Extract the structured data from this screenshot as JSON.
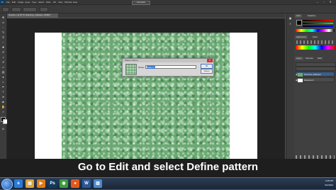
{
  "app": {
    "logo": "Ps",
    "menu": [
      "File",
      "Edit",
      "Image",
      "Layer",
      "Type",
      "Select",
      "Filter",
      "3D",
      "View",
      "Window",
      "Help"
    ],
    "workspace": "Essentials"
  },
  "document": {
    "tab_title": "Snowline 1 @ 66.7% (Raindrops_Wallpaper, RGB/8) *",
    "zoom_status": "66.67%"
  },
  "dialog": {
    "title": "Pattern Name",
    "name_label": "Name:",
    "name_value": "Pattern 1",
    "ok_label": "OK",
    "cancel_label": "Cancel",
    "close_glyph": "✕"
  },
  "panels": {
    "tabs_top": [
      "Color",
      "Swatches"
    ],
    "tabs_mid": [
      "Adjustments",
      "Styles"
    ],
    "tabs_layers": [
      "Layers",
      "Channels",
      "Paths"
    ],
    "layers": [
      {
        "name": "Raindrops_Wallpaper",
        "selected": true
      },
      {
        "name": "Background",
        "selected": false
      }
    ]
  },
  "caption": "Go to Edit and select Define pattern",
  "taskbar": {
    "icons": [
      {
        "name": "ie-icon",
        "glyph": "e",
        "color": "#2a7ad8"
      },
      {
        "name": "folder-icon",
        "glyph": "▤",
        "color": "#d9a441"
      },
      {
        "name": "media-icon",
        "glyph": "▶",
        "color": "#e07b18"
      },
      {
        "name": "photoshop-icon",
        "glyph": "Ps",
        "color": "#0f3a5e"
      },
      {
        "name": "chrome-icon",
        "glyph": "◉",
        "color": "#3c9b3c"
      },
      {
        "name": "firefox-icon",
        "glyph": "●",
        "color": "#e05a1a"
      },
      {
        "name": "word-icon",
        "glyph": "W",
        "color": "#2b5797"
      },
      {
        "name": "explorer-icon",
        "glyph": "▥",
        "color": "#4d88c8"
      }
    ],
    "time": "2:45 PM",
    "date": "9/1/2012"
  },
  "colors": {
    "accent": "#3b73c8",
    "photo_green": "#6aaa72"
  }
}
